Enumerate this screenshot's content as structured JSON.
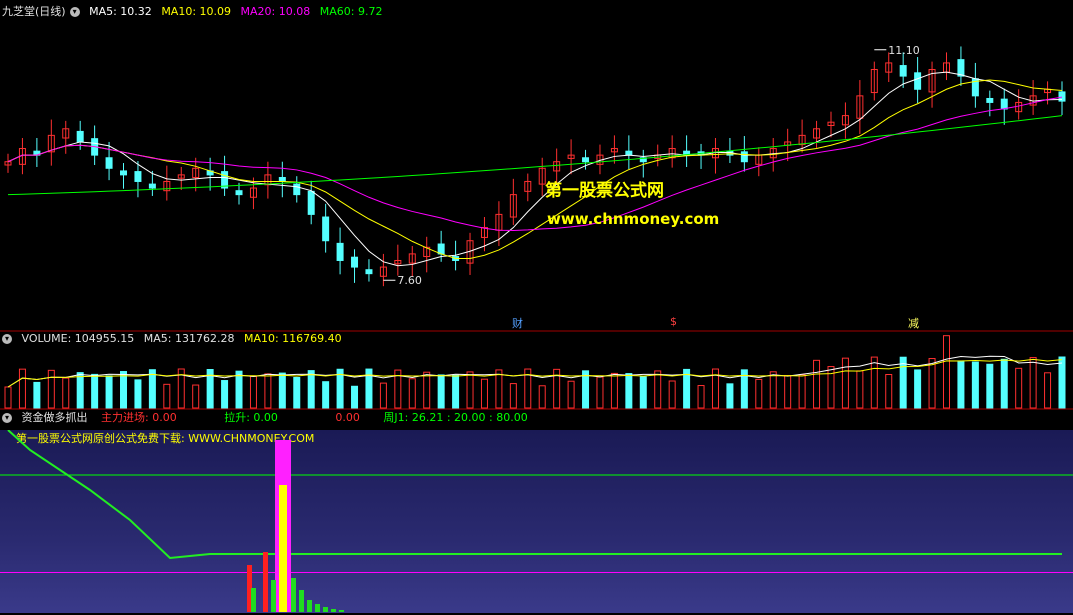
{
  "price_panel": {
    "title": "九芝堂(日线)",
    "ma5_label": "MA5: 10.32",
    "ma10_label": "MA10: 10.09",
    "ma20_label": "MA20: 10.08",
    "ma60_label": "MA60: 9.72",
    "high_label": "11.10",
    "low_label": "7.60",
    "events": [
      "财",
      "$",
      "减"
    ],
    "watermark_cn": "第一股票公式网",
    "watermark_url": "www.chnmoney.com"
  },
  "volume_panel": {
    "volume_label": "VOLUME: 104955.15",
    "ma5_label": "MA5: 131762.28",
    "ma10_label": "MA10: 116769.40"
  },
  "indicator_panel": {
    "title": "资金做多抓出",
    "zhuli_label": "主力进场: 0.00",
    "lasheng_label": "拉升: 0.00",
    "extra_label": "0.00",
    "zhou_label": "周J1: 26.21 : 20.00 : 80.00",
    "promo": "第一股票公式网原创公式免费下载: WWW.CHNMONEY.COM"
  },
  "colors": {
    "up": "#ff3030",
    "down": "#54ffff",
    "ma5": "#ffffff",
    "ma10": "#ffff00",
    "ma20": "#ff00ff",
    "ma60": "#00ff00",
    "axis": "#a00000"
  },
  "chart_data": [
    {
      "type": "candlestick",
      "title": "九芝堂(日线)",
      "series_names": [
        "MA5",
        "MA10",
        "MA20",
        "MA60"
      ],
      "y_marks": {
        "high": 11.1,
        "low": 7.6
      },
      "closes": [
        9.4,
        9.6,
        9.5,
        9.8,
        9.9,
        9.7,
        9.5,
        9.3,
        9.2,
        9.1,
        9.0,
        9.1,
        9.2,
        9.3,
        9.2,
        9.0,
        8.9,
        9.0,
        9.2,
        9.1,
        8.9,
        8.6,
        8.2,
        7.9,
        7.8,
        7.7,
        7.8,
        7.9,
        8.0,
        8.1,
        8.0,
        7.9,
        8.2,
        8.4,
        8.6,
        8.9,
        9.1,
        9.3,
        9.4,
        9.5,
        9.4,
        9.5,
        9.6,
        9.5,
        9.4,
        9.5,
        9.6,
        9.5,
        9.5,
        9.6,
        9.5,
        9.4,
        9.5,
        9.6,
        9.7,
        9.8,
        9.9,
        10.0,
        10.1,
        10.4,
        10.8,
        10.9,
        10.7,
        10.5,
        10.8,
        10.9,
        10.7,
        10.4,
        10.3,
        10.2,
        10.3,
        10.4,
        10.5,
        10.32
      ],
      "ma60_endpoints": [
        8.9,
        10.1
      ]
    },
    {
      "type": "bar",
      "title": "VOLUME",
      "last_value": 104955.15,
      "ma5": 131762.28,
      "ma10": 116769.4
    },
    {
      "type": "line",
      "title": "资金做多抓出",
      "series": [
        {
          "name": "主力进场",
          "last": 0.0
        },
        {
          "name": "拉升",
          "last": 0.0
        },
        {
          "name": "周J1",
          "last": 26.21
        }
      ],
      "reference_lines": [
        20.0,
        80.0
      ]
    }
  ]
}
